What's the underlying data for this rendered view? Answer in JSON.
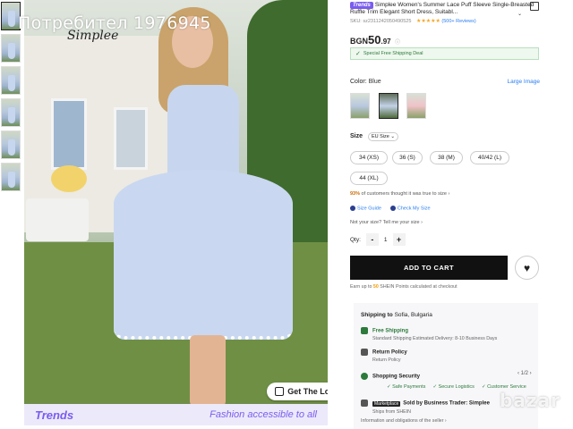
{
  "watermark": {
    "text": "Потребител 1976945"
  },
  "image": {
    "brand_text": "Simplee",
    "look_button": "Get The Look",
    "banner_logo": "Trends",
    "banner_text": "Fashion accessible to all"
  },
  "product": {
    "badge": "Trends",
    "title": "Simplee Women's Summer Lace Puff Sleeve Single-Breasted Ruffle Trim Elegant Short Dress, Suitabl...",
    "sku": "SKU: sz2311242050490525",
    "rating_stars": "★★★★★",
    "reviews": "(500+ Reviews)",
    "price_currency": "BGN",
    "price_main": "50",
    "price_decimal": ".97",
    "price_info": "ⓘ",
    "shipping_deal": "Special Free Shipping Deal"
  },
  "color": {
    "label": "Color:",
    "value": "Blue",
    "large_image": "Large Image"
  },
  "size": {
    "label": "Size",
    "system": "EU Size ⌄",
    "options": [
      "34 (XS)",
      "36 (S)",
      "38 (M)",
      "40/42 (L)",
      "44 (XL)"
    ],
    "fit_percent": "93%",
    "fit_text": "of customers thought it was true to size ›",
    "size_guide": "Size Guide",
    "check_my_size": "Check My Size",
    "not_your_size": "Not your size? Tell me your size ›"
  },
  "qty": {
    "label": "Qty:",
    "minus": "-",
    "value": "1",
    "plus": "+"
  },
  "cart": {
    "add_to_cart": "ADD TO CART",
    "points_prefix": "Earn up to ",
    "points_value": "50",
    "points_suffix": " SHEIN Points calculated at checkout"
  },
  "shipping": {
    "ship_to_label": "Shipping to",
    "ship_to_value": "Sofia, Bulgaria",
    "free_shipping": "Free Shipping",
    "free_shipping_sub": "Standard Shipping Estimated Delivery: 8-10 Business Days",
    "return_policy": "Return Policy",
    "return_policy_sub": "Return Policy",
    "shopping_security": "Shopping Security",
    "pager": "‹ 1/2 ›",
    "tags": [
      "✓ Safe Payments",
      "✓ Secure Logistics",
      "✓ Customer Service"
    ],
    "marketplace_badge": "Marketplace",
    "sold_by": "Sold by Business Trader: Simplee",
    "ships_from": "Ships from SHEIN",
    "info_text": "Information and obligations of the seller ›"
  },
  "footer_watermark": "bazar",
  "colors": {
    "accent": "#7a5cf0",
    "cart": "#111111",
    "green": "#2c7a3c",
    "link": "#2a7ef0"
  }
}
